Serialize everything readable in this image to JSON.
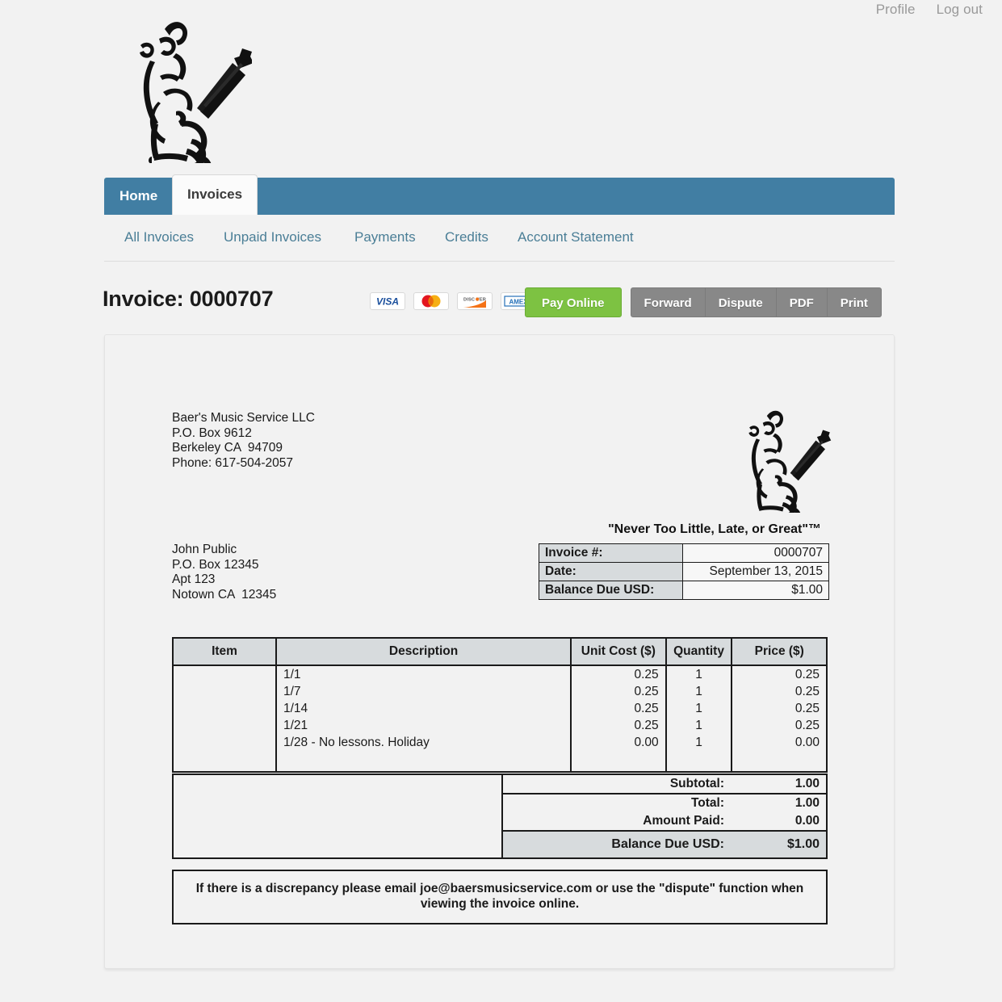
{
  "topbar": {
    "profile": "Profile",
    "logout": "Log out"
  },
  "brand": {
    "logo_name": "guitar-player-logo"
  },
  "nav": {
    "tabs": [
      {
        "label": "Home",
        "active": false
      },
      {
        "label": "Invoices",
        "active": true
      }
    ],
    "subnav": [
      {
        "label": "All Invoices"
      },
      {
        "label": "Unpaid Invoices"
      },
      {
        "label": "Payments"
      },
      {
        "label": "Credits"
      },
      {
        "label": "Account Statement"
      }
    ]
  },
  "header": {
    "title": "Invoice: 0000707",
    "cards": [
      {
        "name": "visa-card-icon",
        "label": "VISA"
      },
      {
        "name": "mastercard-card-icon",
        "label": "Mastercard"
      },
      {
        "name": "discover-card-icon",
        "label": "DISCOVER"
      },
      {
        "name": "amex-card-icon",
        "label": "AMEX"
      }
    ],
    "buttons": {
      "pay_online": "Pay Online",
      "forward": "Forward",
      "dispute": "Dispute",
      "pdf": "PDF",
      "print": "Print"
    }
  },
  "colors": {
    "nav_blue": "#417ea3",
    "link_blue": "#4a7e96",
    "pay_green": "#7dc242",
    "button_gray": "#888888",
    "table_header_gray": "#d7dbdd",
    "page_background": "#f2f2f2"
  },
  "invoice": {
    "from": "Baer's Music Service LLC\nP.O. Box 9612\nBerkeley CA  94709\nPhone: 617-504-2057",
    "to": "John Public\nP.O. Box 12345\nApt 123\nNotown CA  12345",
    "tagline": "\"Never Too Little, Late, or Great\"™",
    "summary": [
      {
        "label": "Invoice #:",
        "value": "0000707"
      },
      {
        "label": "Date:",
        "value": "September 13, 2015"
      },
      {
        "label": "Balance Due USD:",
        "value": "$1.00"
      }
    ],
    "table": {
      "columns": [
        "Item",
        "Description",
        "Unit Cost ($)",
        "Quantity",
        "Price ($)"
      ],
      "rows": [
        {
          "item": "",
          "description": "1/1",
          "unit_cost": "0.25",
          "quantity": "1",
          "price": "0.25"
        },
        {
          "item": "",
          "description": "1/7",
          "unit_cost": "0.25",
          "quantity": "1",
          "price": "0.25"
        },
        {
          "item": "",
          "description": "1/14",
          "unit_cost": "0.25",
          "quantity": "1",
          "price": "0.25"
        },
        {
          "item": "",
          "description": "1/21",
          "unit_cost": "0.25",
          "quantity": "1",
          "price": "0.25"
        },
        {
          "item": "",
          "description": "1/28 - No lessons. Holiday",
          "unit_cost": "0.00",
          "quantity": "1",
          "price": "0.00"
        }
      ]
    },
    "totals": {
      "subtotal_label": "Subtotal:",
      "subtotal_value": "1.00",
      "total_label": "Total:",
      "total_value": "1.00",
      "amount_paid_label": "Amount Paid:",
      "amount_paid_value": "0.00",
      "balance_label": "Balance Due USD:",
      "balance_value": "$1.00"
    },
    "note": "If there is a discrepancy please email joe@baersmusicservice.com or use the \"dispute\" function when viewing the invoice online."
  }
}
